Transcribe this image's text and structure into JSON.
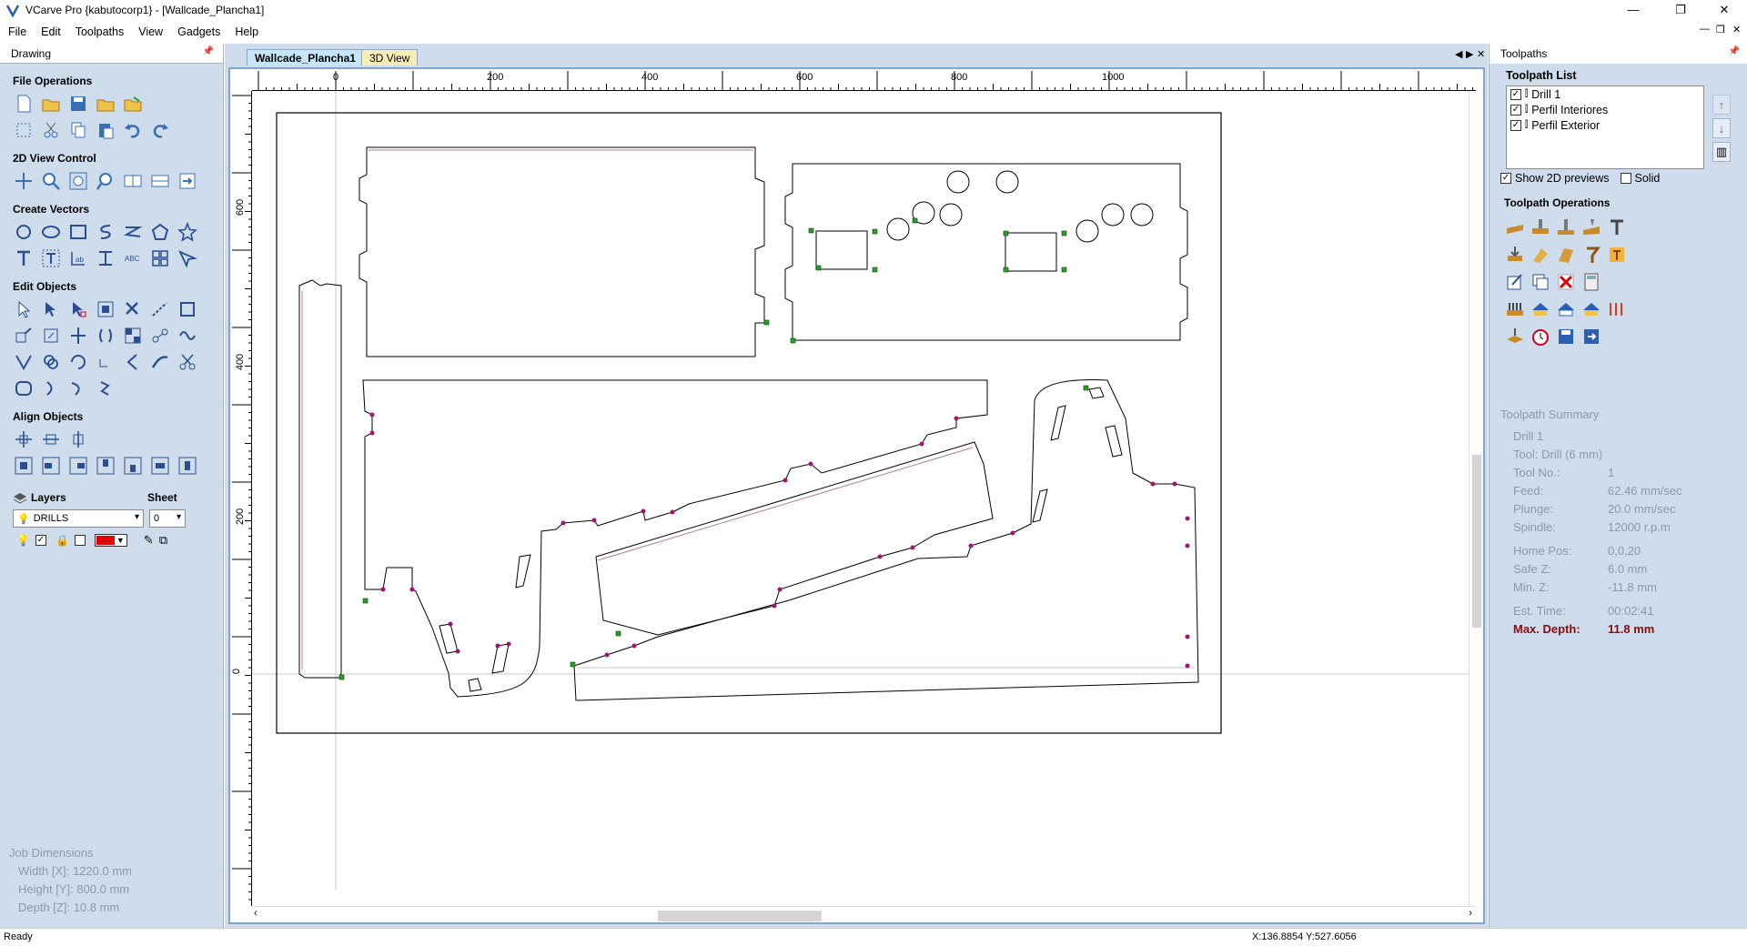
{
  "window": {
    "title": "VCarve Pro {kabutocorp1} - [Wallcade_Plancha1]",
    "controls": [
      "—",
      "❐",
      "✕"
    ]
  },
  "menu": [
    "File",
    "Edit",
    "Toolpaths",
    "View",
    "Gadgets",
    "Help"
  ],
  "left_panel": {
    "title": "Drawing",
    "sections": {
      "file_ops": "File Operations",
      "view_control": "2D View Control",
      "create_vectors": "Create Vectors",
      "edit_objects": "Edit Objects",
      "align_objects": "Align Objects"
    },
    "layers_label": "Layers",
    "sheet_label": "Sheet",
    "layer_value": "DRILLS",
    "sheet_value": "0",
    "layer_color": "#e00000"
  },
  "job_dimensions": {
    "title": "Job Dimensions",
    "width": "Width  [X]: 1220.0 mm",
    "height": "Height [Y]: 800.0 mm",
    "depth": "Depth  [Z]: 10.8 mm"
  },
  "doc": {
    "tabs": [
      "Wallcade_Plancha1",
      "3D View"
    ],
    "ruler_top": [
      "0",
      "200",
      "400",
      "600",
      "800",
      "1000"
    ],
    "ruler_left": [
      "600",
      "400",
      "200",
      "0"
    ]
  },
  "right_panel": {
    "title": "Toolpaths",
    "list_title": "Toolpath List",
    "toolpaths": [
      {
        "name": "Drill 1",
        "checked": true
      },
      {
        "name": "Perfil Interiores",
        "checked": true
      },
      {
        "name": "Perfil Exterior",
        "checked": true
      }
    ],
    "show_previews": "Show 2D previews",
    "solid": "Solid",
    "operations_title": "Toolpath Operations",
    "summary_title": "Toolpath Summary",
    "summary_name": "Drill 1",
    "summary_tool": "Tool: Drill (6 mm)",
    "summary_rows": [
      {
        "k": "Tool No.:",
        "v": "1"
      },
      {
        "k": "Feed:",
        "v": "62.46 mm/sec"
      },
      {
        "k": "Plunge:",
        "v": "20.0 mm/sec"
      },
      {
        "k": "Spindle:",
        "v": "12000 r.p.m"
      },
      {
        "k": "Home Pos:",
        "v": "0,0,20"
      },
      {
        "k": "Safe Z:",
        "v": "6.0 mm"
      },
      {
        "k": "Min. Z:",
        "v": "-11.8 mm"
      },
      {
        "k": "Est. Time:",
        "v": "00:02:41"
      }
    ],
    "max_depth_label": "Max. Depth:",
    "max_depth_value": "11.8 mm"
  },
  "status": {
    "left": "Ready",
    "coords": "X:136.8854 Y:527.6056"
  }
}
